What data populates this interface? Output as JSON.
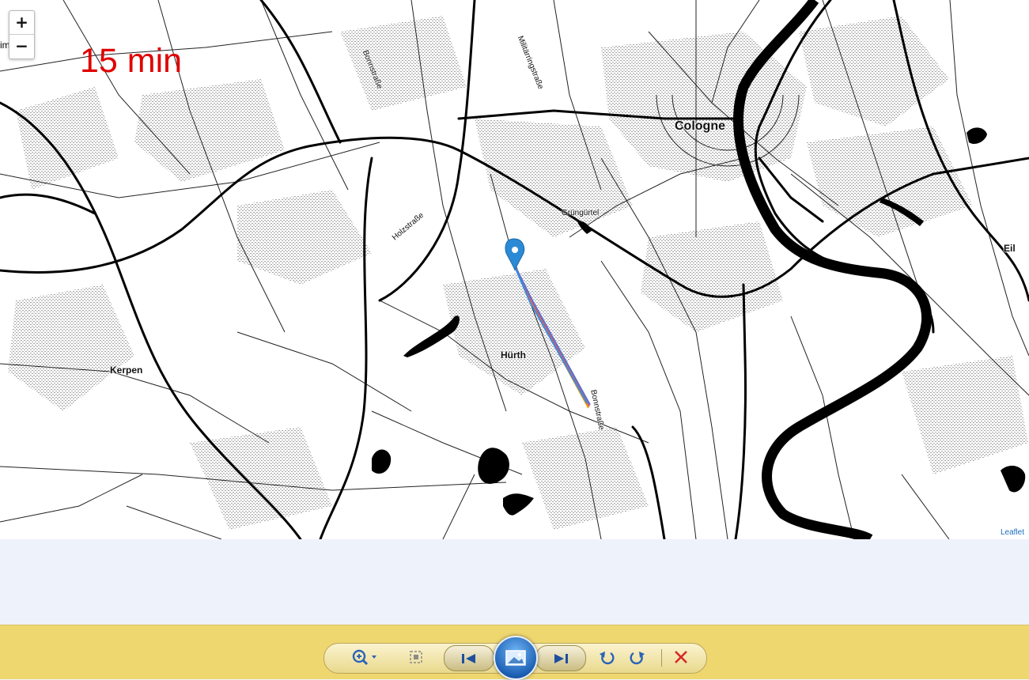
{
  "map": {
    "zoom_in_label": "+",
    "zoom_out_label": "−",
    "edge_label": "im",
    "time_overlay": "15 min",
    "attribution": "Leaflet",
    "places": {
      "cologne": "Cologne",
      "hurth": "Hürth",
      "kerpen": "Kerpen",
      "eil": "Eil"
    },
    "streets": {
      "bonnstrasse_north": "Bonnstraße",
      "militaerringstrasse": "Militärringstraße",
      "holzstrasse": "Holzstraße",
      "gruenguertel": "Grüngürtel",
      "bonnstrasse_south": "Bonnstraße"
    },
    "route_colors": [
      "#f4a300",
      "#e85a5a",
      "#5b6fd0",
      "#3a8dde"
    ],
    "marker_color": "#2b8ad6"
  },
  "toolbar": {
    "icons": [
      "zoom-icon",
      "actual-size-icon",
      "previous-icon",
      "slideshow-icon",
      "next-icon",
      "rotate-left-icon",
      "rotate-right-icon",
      "delete-icon"
    ],
    "accent": "#1d5fb4",
    "delete_color": "#d42a2a"
  }
}
